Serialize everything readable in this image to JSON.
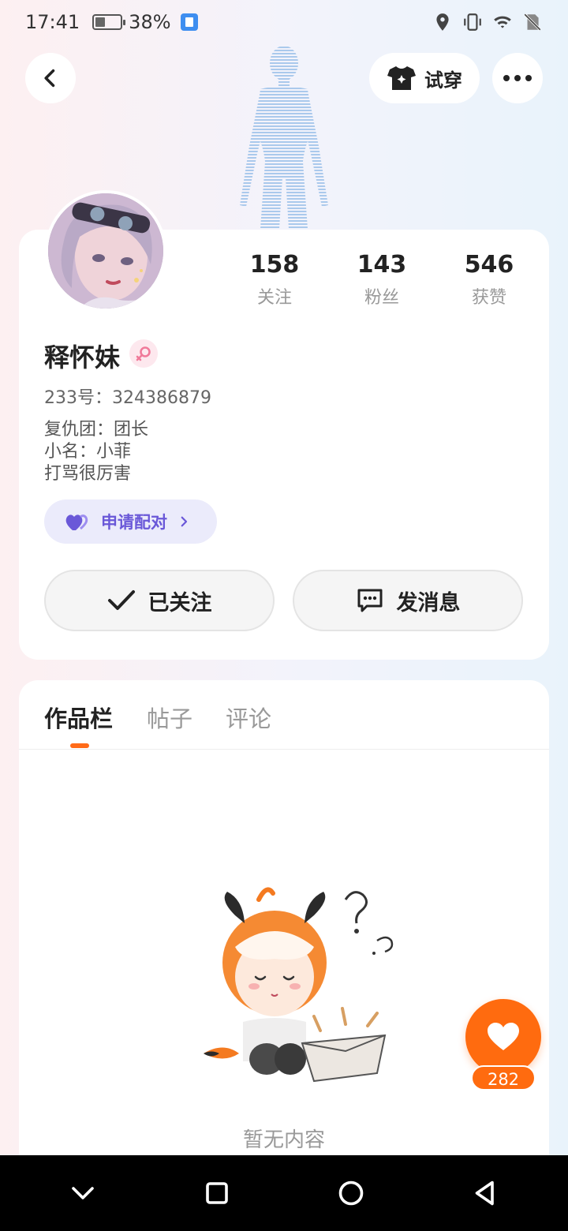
{
  "status_bar": {
    "time": "17:41",
    "battery_percent": "38%",
    "icons": [
      "battery-icon",
      "app-badge-icon",
      "location-icon",
      "vibrate-icon",
      "wifi-icon",
      "no-sim-icon"
    ]
  },
  "header": {
    "back_icon": "chevron-left-icon",
    "try_on_label": "试穿",
    "more_icon": "more-dots-icon"
  },
  "profile": {
    "name": "释怀妹",
    "gender": "female",
    "id_line": "233号：324386879",
    "bio_lines": [
      "复仇团：团长",
      "小名：小菲",
      "打骂很厉害"
    ],
    "stats": [
      {
        "value": "158",
        "label": "关注"
      },
      {
        "value": "143",
        "label": "粉丝"
      },
      {
        "value": "546",
        "label": "获赞"
      }
    ],
    "pair_label": "申请配对",
    "follow_label": "已关注",
    "message_label": "发消息"
  },
  "tabs": [
    {
      "label": "作品栏",
      "active": true
    },
    {
      "label": "帖子",
      "active": false
    },
    {
      "label": "评论",
      "active": false
    }
  ],
  "empty_state": {
    "text": "暂无内容"
  },
  "like": {
    "count": "282"
  },
  "colors": {
    "accent_orange": "#ff6b0f",
    "pair_purple": "#6a58d8",
    "pair_bg": "#ebebfb"
  }
}
